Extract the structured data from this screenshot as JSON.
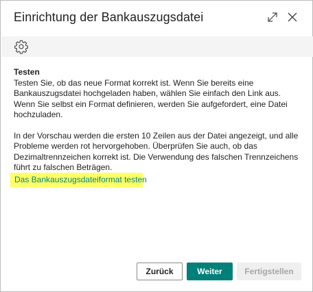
{
  "dialog": {
    "title": "Einrichtung der Bankauszugsdatei",
    "expand_icon": "expand-icon",
    "close_icon": "close-icon"
  },
  "toolbar": {
    "settings_icon": "gear-icon"
  },
  "content": {
    "heading": "Testen",
    "paragraph1": "Testen Sie, ob das neue Format korrekt ist. Wenn Sie bereits eine Bankauszugsdatei hochgeladen haben, wählen Sie einfach den Link aus. Wenn Sie selbst ein Format definieren, werden Sie aufgefordert, eine Datei hochzuladen.",
    "paragraph2": "In der Vorschau werden die ersten 10 Zeilen aus der Datei angezeigt, und alle Probleme werden rot hervorgehoben. Überprüfen Sie auch, ob das Dezimaltrennzeichen korrekt ist. Die Verwendung des falschen Trennzeichens führt zu falschen Beträgen.",
    "test_link": "Das Bankauszugsdateiformat testen"
  },
  "footer": {
    "back_label": "Zurück",
    "next_label": "Weiter",
    "finish_label": "Fertigstellen"
  },
  "colors": {
    "accent": "#008078",
    "link": "#00857c",
    "highlight": "#ffff66"
  }
}
